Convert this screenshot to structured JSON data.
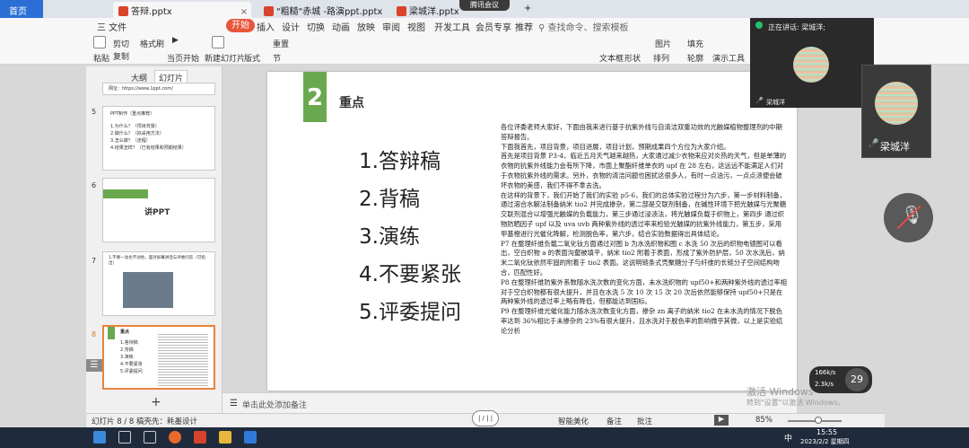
{
  "tabs": {
    "home": "首页",
    "t1": "答辩.pptx",
    "t2": "\"粗糙\"赤城 -路演ppt.pptx",
    "t3": "梁城洋.pptx",
    "meeting": "腾讯会议"
  },
  "menu": {
    "file": "三 文件",
    "start": "开始",
    "insert": "插入",
    "design": "设计",
    "transition": "切换",
    "animation": "动画",
    "show": "放映",
    "review": "审阅",
    "view": "视图",
    "dev": "开发工具",
    "member": "会员专享",
    "ext": "推荐",
    "search": "查找命令、搜索模板"
  },
  "ribbon": {
    "paste": "粘贴",
    "cut": "剪切",
    "copy": "复制",
    "format": "格式刷",
    "play": "当页开始",
    "newslide": "新建幻灯片",
    "layout": "版式",
    "section": "节",
    "reset": "重置",
    "textbox": "文本框",
    "shape": "形状",
    "arrange": "排列",
    "picture": "图片",
    "fill": "填充",
    "outline": "轮廓",
    "present": "演示工具",
    "replace": "替换"
  },
  "leftpane": {
    "tab_outline": "大纲",
    "tab_slides": "幻灯片",
    "thumb4_url": "网址：https://www.1ppt.com/",
    "thumb5": {
      "num": "5",
      "title": "PPT制作（重点推荐）",
      "lines": [
        "1.为什么？（项目背景）",
        "2.做什么？（拟采用方法）",
        "3.怎么做？（流程）",
        "4.结果怎样？（已有结果和预期结果）"
      ]
    },
    "thumb6": {
      "num": "6",
      "title": "讲PPT"
    },
    "thumb7": {
      "num": "7",
      "text": "1.不要一动也不动地，面对屏幕讲话与评委问答（可指出）"
    },
    "thumb8": {
      "num": "8",
      "title": "重点",
      "lines": [
        "1.答辩稿",
        "2.背稿",
        "3.演练",
        "4.不要紧张",
        "5.评委提问"
      ]
    },
    "add": "+"
  },
  "slide": {
    "badge": "2",
    "title": "重点",
    "bullets": [
      "1.答辩稿",
      "2.背稿",
      "3.演练",
      "4.不要紧张",
      "5.评委提问"
    ],
    "speech": [
      "各位评委老师大家好，下面由我来进行基于抗紫外线与自清洁双重功效的光触媒植物整理剂的中期答辩报告。",
      "下面我首先，项目背景，项目进展，项目计划，预期成果四个方位为大家介绍。",
      "首先是项目背景 P3-4，临近五月天气越来越热，大家通过减少衣物来应对炎热的天气，但是单薄的衣物的抗紫外线能力会有所下降，市面上聚酯纤维单衣的 upf 在 28 左右，这远远不能满足人们对于衣物抗紫外线的需求。另外，衣物的清洁问题也困扰这很多人，有时一点油污，一点点渍便会破坏衣物的美感，我们不得不拿去洗。",
      "在这样的背景下，我们开始了我们的实验 p5-6，我们的总体实验过程分为六步，第一步材料制备，通过溶合水解法制备纳米 tio2 并完成掺杂，第二部是交联剂制备，在碱性环境下把光触媒与光聚糖交联剂混合以增强光触媒的负载能力，第三步通过浸渍法，将光触媒负载于织物上，第四步 通过织物防晒因子 upf 以及 uva uvb 两种紫外线的透过率来检验光触媒的抗紫外线能力，第五步，采用甲基橙进行光催化降解，检测脱色率，第六步，结合实验数据得出具体结论。",
      "P7 在整理纤维负载二氧化钛方面通过对图 b 为水洗织物和图 c 水洗 50 次后的织物电镜图可以看出，空白织物 a 的表面沟壑被填平，纳米 tio2 附着于表面，形成了紫外防护层，50 次水洗后，纳米二氧化钛依然牢固的附着于 tio2 表面。这说明链条式壳聚糖分子与纤维的长链分子空间结构吻合，匹配性好。",
      "P8 在整理纤维防紫外系数随水洗次数的变化方面，未水洗织物的 upf50+和两种紫外线的透过率相对于空白织物都有很大提升，并且在水洗 5 次 10 次 15 次 20 次后依然能够保持 upf50+只是在两种紫外线的透过率上略有降低，但都能达到国标。",
      "P9 在整理纤维光催化能力随水洗次数变化方面，掺杂 zn 离子的纳米 tio2 在未水洗的情况下脱色率达到 36%相比于未掺杂的 23%有很大提升，且水洗对于脱色率的影响微乎其微，以上是实验结论分析"
    ]
  },
  "notes": {
    "placeholder": "单击此处添加备注"
  },
  "status": {
    "slide": "幻灯片 8 / 8",
    "theme": "稿壳先：耗墨设计",
    "page_btn": "| / | |",
    "beautify": "智能美化",
    "comment": "备注",
    "annot": "批注",
    "zoom": "85%"
  },
  "video": {
    "speaking": "正在讲话: 梁城洋;",
    "small_name": "梁城洋",
    "big_name": "梁城洋"
  },
  "speed": {
    "percent": "29",
    "up": "166k/s",
    "down": "2.3k/s"
  },
  "watermark": {
    "line1": "激活 Windows",
    "line2": "转到\"设置\"以激活 Windows。"
  },
  "taskbar": {
    "time": "15:55",
    "date": "2023/2/2 星期四",
    "lang": "中"
  }
}
